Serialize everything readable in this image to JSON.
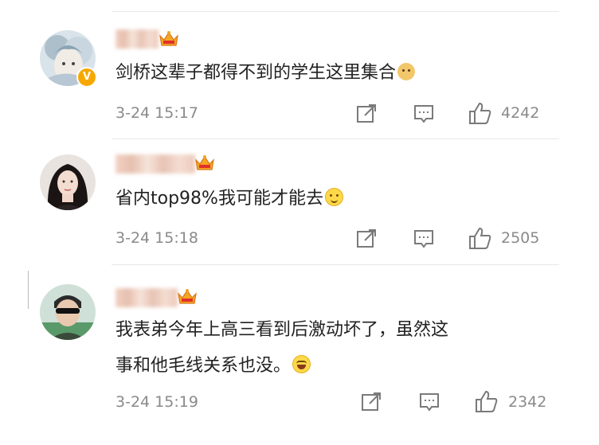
{
  "comments": [
    {
      "text": "剑桥这辈子都得不到的学生这里集合",
      "emoji": "doge-emoji",
      "timestamp": "3-24 15:17",
      "likes": "4242",
      "verified_badge": "V"
    },
    {
      "text": "省内top98%我可能才能去",
      "emoji": "smile-emoji",
      "timestamp": "3-24 15:18",
      "likes": "2505"
    },
    {
      "text_line1": "我表弟今年上高三看到后激动坏了，虽然这",
      "text_line2": "事和他毛线关系也没。",
      "emoji": "laugh-cry-emoji",
      "timestamp": "3-24 15:19",
      "likes": "2342"
    }
  ],
  "icons": {
    "share": "share-icon",
    "reply": "comment-icon",
    "like": "thumbs-up-icon",
    "crown": "crown-badge-icon"
  },
  "colors": {
    "text": "#222222",
    "meta": "#8a8a8a",
    "crown": "#f5a623",
    "verified": "#f6a800"
  }
}
